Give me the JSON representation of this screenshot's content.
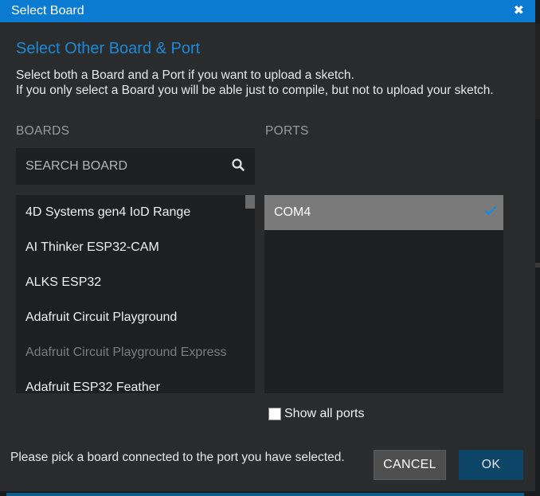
{
  "window": {
    "title": "Select Board"
  },
  "dialog": {
    "heading": "Select Other Board & Port",
    "description_line1": "Select both a Board and a Port if you want to upload a sketch.",
    "description_line2": "If you only select a Board you will be able just to compile, but not to upload your sketch."
  },
  "boards": {
    "label": "BOARDS",
    "search_placeholder": "SEARCH BOARD",
    "items": [
      {
        "label": "4D Systems gen4 IoD Range"
      },
      {
        "label": "AI Thinker ESP32-CAM"
      },
      {
        "label": "ALKS ESP32"
      },
      {
        "label": "Adafruit Circuit Playground"
      },
      {
        "label": "Adafruit Circuit Playground Express"
      },
      {
        "label": "Adafruit ESP32 Feather"
      }
    ]
  },
  "ports": {
    "label": "PORTS",
    "items": [
      {
        "label": "COM4",
        "selected": true
      }
    ],
    "show_all_label": "Show all ports"
  },
  "footer": {
    "message": "Please pick a board connected to the port you have selected.",
    "cancel_label": "CANCEL",
    "ok_label": "OK"
  },
  "colors": {
    "titlebar": "#0b7ad1",
    "heading": "#1a8ad8",
    "ok_button": "#0d4568",
    "check": "#1a8ad8"
  }
}
